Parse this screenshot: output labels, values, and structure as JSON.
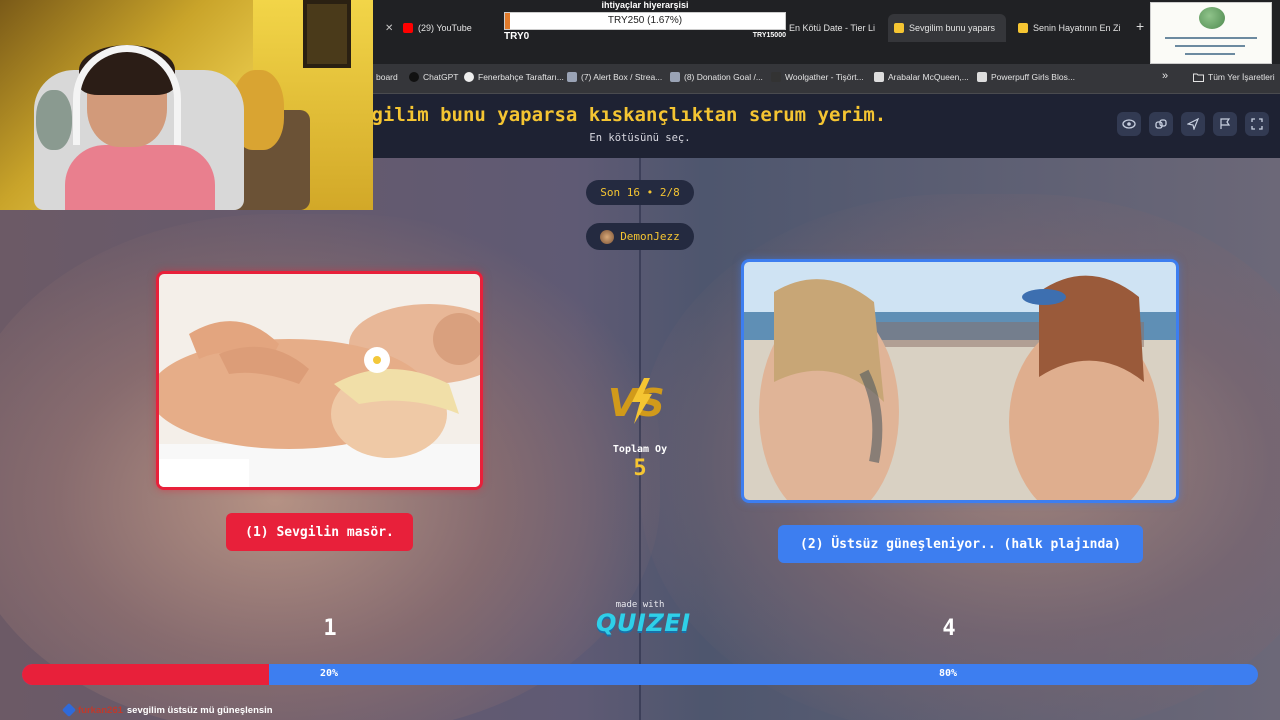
{
  "browser": {
    "tabs": [
      {
        "label": "(29) YouTube",
        "color": "#ff0000",
        "active": false
      },
      {
        "label": "En Kötü Date - Tier Li",
        "color": "#f5c532",
        "active": false
      },
      {
        "label": "Sevgilim bunu yapars",
        "color": "#f5c532",
        "active": true
      },
      {
        "label": "Senin Hayatının En Zi",
        "color": "#f5c532",
        "active": false
      }
    ],
    "new_tab": "+",
    "bookmarks": [
      {
        "label": "board"
      },
      {
        "label": "ChatGPT"
      },
      {
        "label": "Fenerbahçe Taraftarı..."
      },
      {
        "label": "(7) Alert Box / Strea..."
      },
      {
        "label": "(8) Donation Goal /..."
      },
      {
        "label": "Woolgather - Tişört..."
      },
      {
        "label": "Arabalar McQueen,..."
      },
      {
        "label": "Powerpuff Girls Blos..."
      }
    ],
    "more": "»",
    "all_bookmarks": "Tüm Yer İşaretleri"
  },
  "donation_goal": {
    "title": "ihtiyaçlar hiyerarşisi",
    "amount": "TRY250 (1.67%)",
    "min": "TRY0",
    "max": "TRY15000",
    "progress_fraction": 0.0167,
    "fill_color": "#e07b2c"
  },
  "quiz": {
    "title": "vgilim bunu yaparsa kıskançlıktan serum yerim.",
    "subtitle": "En kötüsünü seç.",
    "round": "Son 16 • 2/8",
    "author": "DemonJezz",
    "header_icons": [
      "eye-icon",
      "link-icon",
      "send-icon",
      "flag-icon",
      "fullscreen-icon"
    ],
    "options": [
      {
        "label": "(1) Sevgilin masör.",
        "votes": "1",
        "percent": "20%",
        "fraction": 0.2,
        "color": "#e8203a"
      },
      {
        "label": "(2) Üstsüz güneşleniyor.. (halk plajında)",
        "votes": "4",
        "percent": "80%",
        "fraction": 0.8,
        "color": "#3d7ef0"
      }
    ],
    "total_label": "Toplam Oy",
    "total_value": "5",
    "made_with": "made with",
    "brand": "QUIZEI",
    "accent_color": "#f5c532"
  },
  "chat": {
    "user": "furkan261",
    "message": "sevgilim üstsüz mü güneşlensin"
  }
}
